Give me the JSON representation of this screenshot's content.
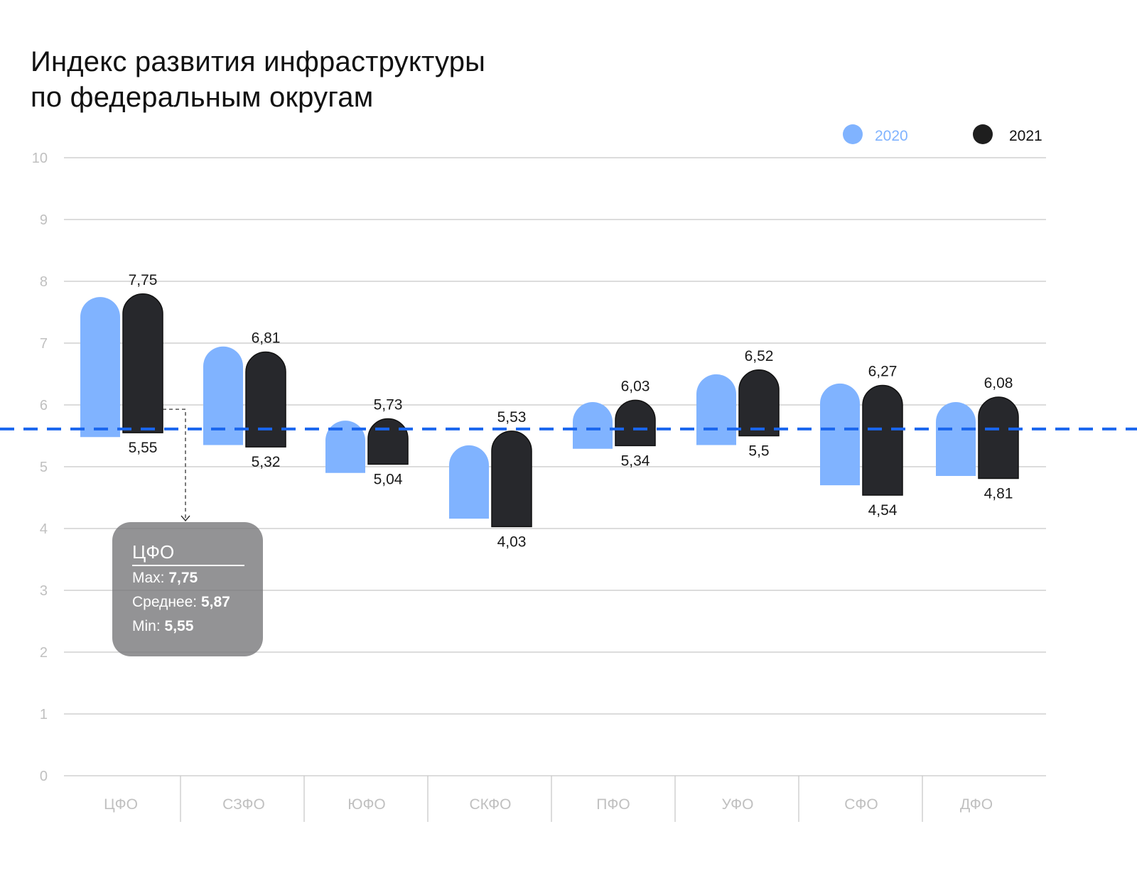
{
  "title_lines": [
    "Индекс развития инфраструктуры",
    "по федеральным округам"
  ],
  "chart_data": {
    "type": "bar",
    "subtype": "floating-range",
    "title": "Индекс развития инфраструктуры по федеральным округам",
    "xlabel": "",
    "ylabel": "",
    "ylim": [
      0,
      10
    ],
    "yticks": [
      0,
      1,
      2,
      3,
      4,
      5,
      6,
      7,
      8,
      9,
      10
    ],
    "grid": true,
    "legend_position": "top-right",
    "categories": [
      "ЦФО",
      "СЗФО",
      "ЮФО",
      "СКФО",
      "ПФО",
      "УФО",
      "СФО",
      "ДФО"
    ],
    "series": [
      {
        "name": "2020",
        "color": "#80b3ff",
        "max": [
          7.7,
          6.9,
          5.7,
          5.3,
          6.0,
          6.45,
          6.3,
          6.0
        ],
        "min": [
          5.48,
          5.35,
          4.9,
          4.16,
          5.29,
          5.35,
          4.7,
          4.85
        ]
      },
      {
        "name": "2021",
        "color": "#27282c",
        "max": [
          7.75,
          6.81,
          5.73,
          5.53,
          6.03,
          6.52,
          6.27,
          6.08
        ],
        "min": [
          5.55,
          5.32,
          5.04,
          4.03,
          5.34,
          5.5,
          4.54,
          4.81
        ],
        "max_labels": [
          "7,75",
          "6,81",
          "5,73",
          "5,53",
          "6,03",
          "6,52",
          "6,27",
          "6,08"
        ],
        "min_labels": [
          "5,55",
          "5,32",
          "5,04",
          "4,03",
          "5,34",
          "5,5",
          "4,54",
          "4,81"
        ]
      }
    ],
    "reference_line": {
      "value": 5.61,
      "style": "dashed",
      "color": "#1a66ee"
    },
    "colors": {
      "grid": "#c8c8c8",
      "tick_text": "#c0c0c0",
      "legend_2020_text": "#80b3ff",
      "legend_2021_text": "#111111"
    }
  },
  "legend": [
    {
      "label": "2020",
      "color": "#80b3ff"
    },
    {
      "label": "2021",
      "color": "#1e1e1e"
    }
  ],
  "tooltip": {
    "title": "ЦФО",
    "max_label": "Max: ",
    "max_value": "7,75",
    "avg_label": "Среднее: ",
    "avg_value": "5,87",
    "min_label": "Min: ",
    "min_value": "5,55"
  }
}
